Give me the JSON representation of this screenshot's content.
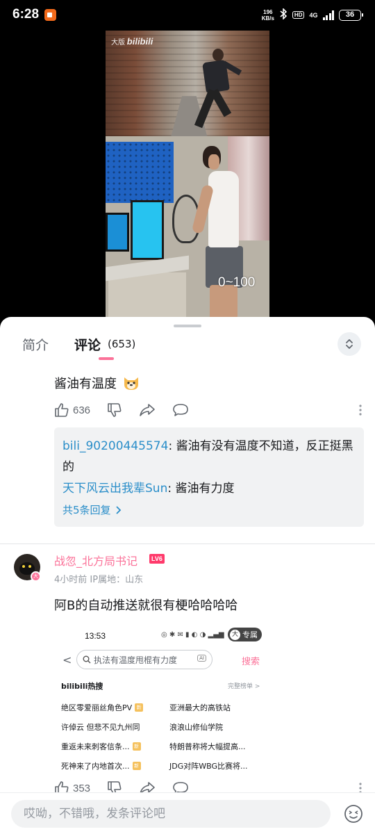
{
  "status_bar": {
    "time": "6:28",
    "net_speed_value": "196",
    "net_speed_unit": "KB/s",
    "hd": "HD",
    "network": "4G",
    "battery": "36"
  },
  "video": {
    "watermark_prefix": "大版",
    "watermark_brand": "bilibili",
    "caption": "0~100"
  },
  "tabs": {
    "intro": "简介",
    "comments": "评论",
    "comment_count": "(653)"
  },
  "comment1": {
    "text": "酱油有温度",
    "likes": "636"
  },
  "replies": [
    {
      "user": "bili_90200445574",
      "sep": ": ",
      "text": "酱油有没有温度不知道，反正挺黑的"
    },
    {
      "user": "天下风云出我辈Sun",
      "sep": ": ",
      "text": "酱油有力度"
    }
  ],
  "replies_more": "共5条回复",
  "comment2": {
    "username": "战忽_北方局书记",
    "level": "LV6",
    "time": "4小时前",
    "ip_label": "IP属地：山东",
    "text": "阿B的自动推送就很有梗哈哈哈哈",
    "likes": "353"
  },
  "embed": {
    "time": "13:53",
    "sys_icons": "◎ ✱ ✉ ▮ ◐ ◑ ▂▄▆",
    "badge_char": "大",
    "badge_text": "专属",
    "back": "<",
    "query": "执法有温度甩棍有力度",
    "search_button": "搜索",
    "hot_title": "bilibili热搜",
    "full_list": "完整榜单 >",
    "hot_items": [
      {
        "text": "绝区零爱丽丝角色PV",
        "new": true
      },
      {
        "text": "亚洲最大的高铁站",
        "new": false
      },
      {
        "text": "许倬云 但悲不见九州同",
        "new": false
      },
      {
        "text": "浪浪山修仙学院",
        "new": false
      },
      {
        "text": "重返未来刺客信条...",
        "new": true
      },
      {
        "text": "特朗普称将大幅提高...",
        "new": false
      },
      {
        "text": "死神来了内地首次...",
        "new": true
      },
      {
        "text": "JDG对阵WBG比赛将...",
        "new": false
      }
    ],
    "new_tag": "新"
  },
  "input": {
    "placeholder": "哎呦，不错哦，发条评论吧"
  },
  "colors": {
    "accent_pink": "#fb7299",
    "link_blue": "#2a8ec9",
    "text_gray": "#61666d"
  }
}
